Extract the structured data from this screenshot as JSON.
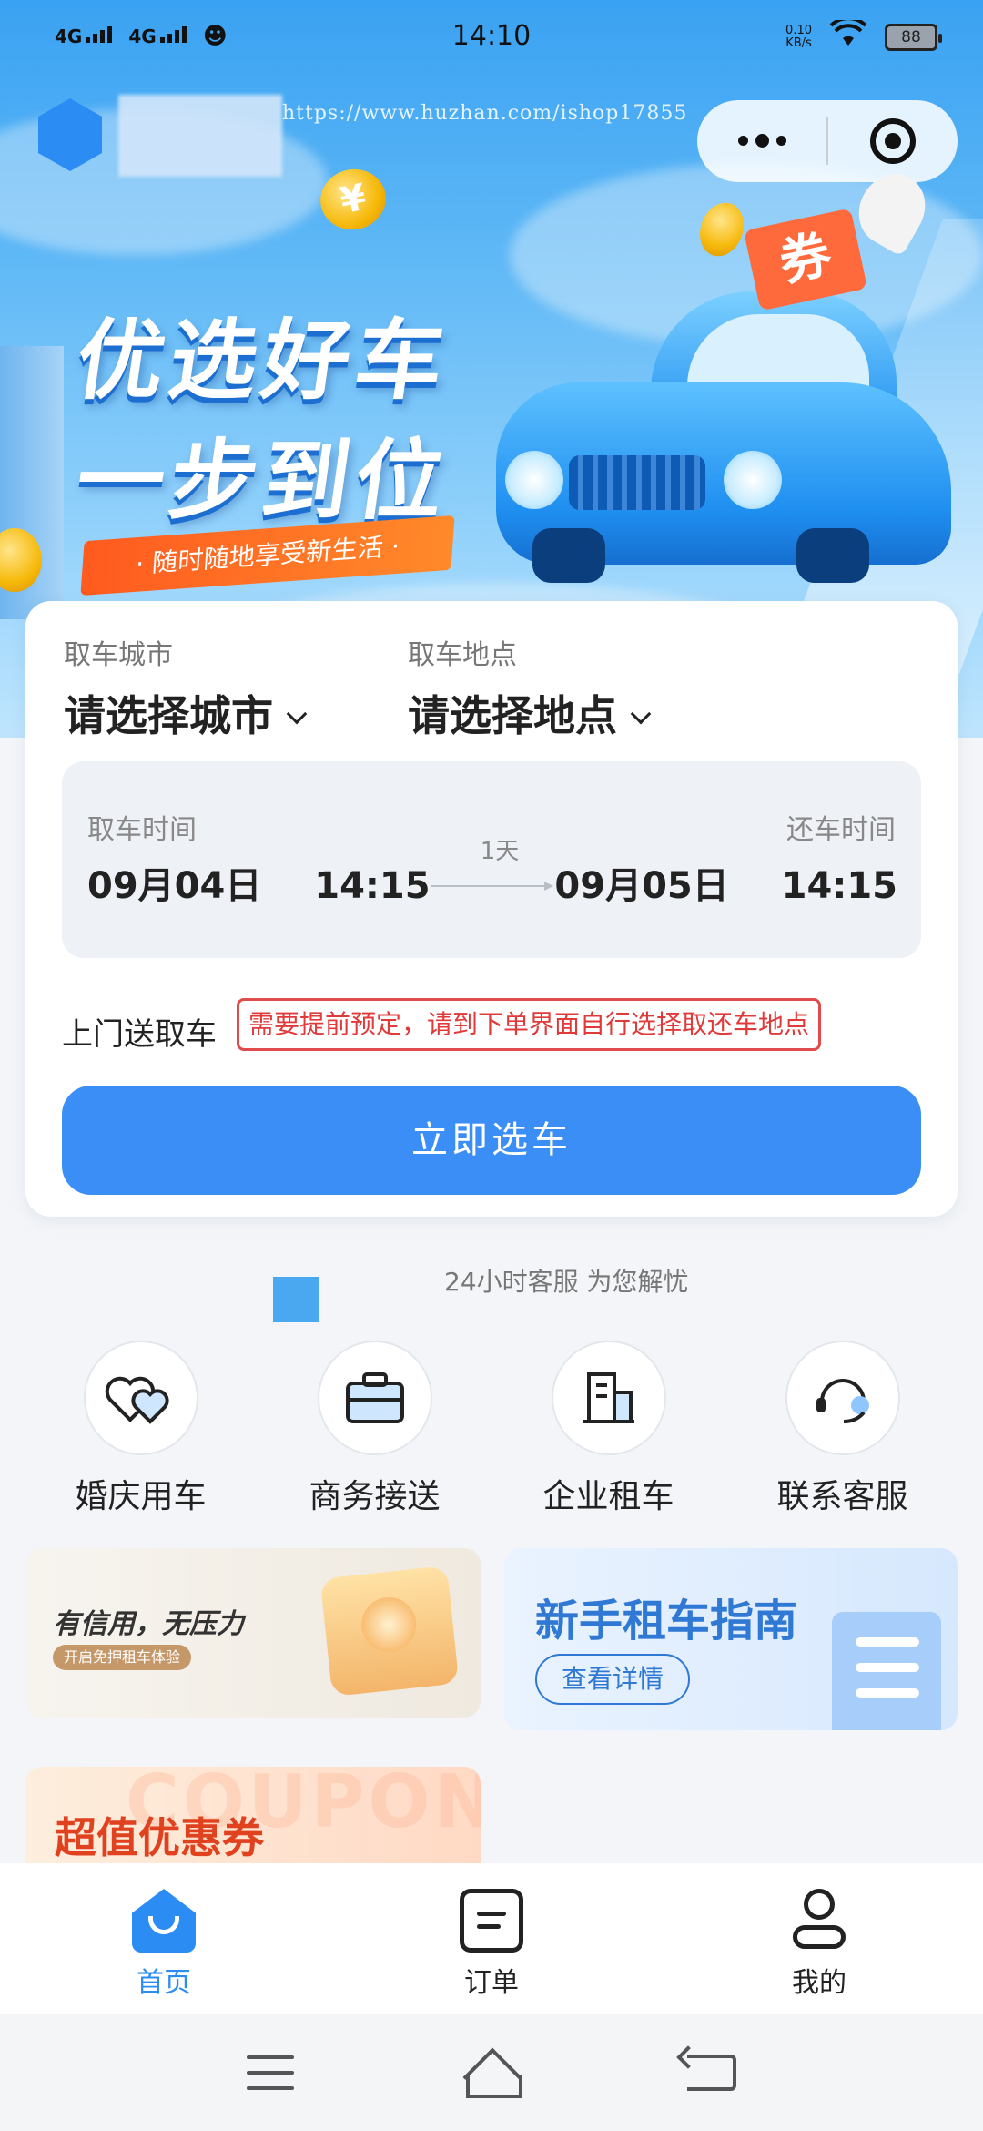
{
  "status_bar": {
    "network_1": "4G",
    "network_2": "4G",
    "time": "14:10",
    "speed": "0.10",
    "speed_unit": "KB/s",
    "battery": "88"
  },
  "header": {
    "watermark": "https://www.huzhan.com/ishop17855",
    "more_icon": "more-dots-icon",
    "close_icon": "target-icon"
  },
  "banner": {
    "line1": "优选好车",
    "line2": "一步到位",
    "tagline": "· 随时随地享受新生活 ·",
    "coin_char": "¥",
    "flag_char": "券"
  },
  "booking": {
    "city_label": "取车城市",
    "city_value": "请选择城市",
    "location_label": "取车地点",
    "location_value": "请选择地点",
    "pickup_label": "取车时间",
    "pickup_date": "09月04日",
    "pickup_time": "14:15",
    "duration": "1天",
    "return_label": "还车时间",
    "return_date": "09月05日",
    "return_time": "14:15",
    "delivery_label": "上门送取车",
    "delivery_note": "需要提前预定，请到下单界面自行选择取还车地点",
    "submit": "立即选车"
  },
  "service": {
    "text": "24小时客服 为您解忧"
  },
  "quick_actions": [
    {
      "label": "婚庆用车",
      "icon": "hearts-icon"
    },
    {
      "label": "商务接送",
      "icon": "briefcase-icon"
    },
    {
      "label": "企业租车",
      "icon": "building-icon"
    },
    {
      "label": "联系客服",
      "icon": "headset-icon"
    }
  ],
  "promos": {
    "credit_title": "有信用，无压力",
    "credit_tag": "开启免押租车体验",
    "guide_title": "新手租车指南",
    "guide_button": "查看详情",
    "coupon_bg": "COUPON",
    "coupon_title": "超值优惠券"
  },
  "tabbar": [
    {
      "label": "首页",
      "icon": "home-icon",
      "active": true
    },
    {
      "label": "订单",
      "icon": "order-icon",
      "active": false
    },
    {
      "label": "我的",
      "icon": "profile-icon",
      "active": false
    }
  ],
  "colors": {
    "primary": "#3a8ef6",
    "tab_active": "#2b8cf3",
    "note_red": "#e03a3a"
  }
}
